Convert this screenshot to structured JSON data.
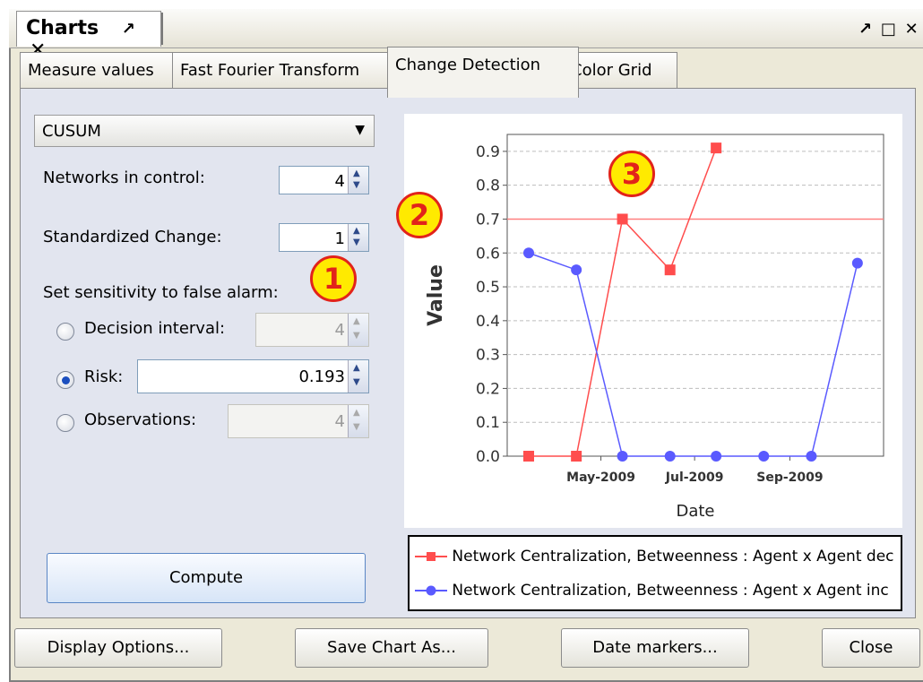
{
  "panel": {
    "title": "Charts",
    "pin_icon": "pin-icon",
    "close_icon": "close-icon"
  },
  "window_controls": {
    "pin_icon": "pin-icon",
    "maximize_icon": "maximize-icon",
    "close_icon": "close-icon"
  },
  "tabs": [
    {
      "label": "Measure values",
      "active": false
    },
    {
      "label": "Fast Fourier Transform",
      "active": false
    },
    {
      "label": "Change Detection",
      "active": true
    },
    {
      "label": "Color Grid",
      "active": false
    }
  ],
  "controls": {
    "method": "CUSUM",
    "networks_in_control_label": "Networks in control:",
    "networks_in_control_value": "4",
    "standardized_change_label": "Standardized Change:",
    "standardized_change_value": "1",
    "sensitivity_label": "Set sensitivity to false alarm:",
    "decision_interval_label": "Decision interval:",
    "decision_interval_value": "4",
    "risk_label": "Risk:",
    "risk_value": "0.193",
    "observations_label": "Observations:",
    "observations_value": "4",
    "selected_option": "risk",
    "compute_label": "Compute"
  },
  "callouts": [
    "1",
    "2",
    "3"
  ],
  "footer": {
    "display_options": "Display Options...",
    "save_chart": "Save Chart As...",
    "date_markers": "Date markers...",
    "close": "Close"
  },
  "colors": {
    "red_series": "#ff4d4d",
    "blue_series": "#5a5aff",
    "threshold": "#ff8080",
    "badge": "#ffea00"
  },
  "chart_data": {
    "type": "line",
    "xlabel": "Date",
    "ylabel": "Value",
    "ylim": [
      0,
      0.95
    ],
    "yticks": [
      "0.0",
      "0.1",
      "0.2",
      "0.3",
      "0.4",
      "0.5",
      "0.6",
      "0.7",
      "0.8",
      "0.9"
    ],
    "xticks": [
      "May-2009",
      "Jul-2009",
      "Sep-2009"
    ],
    "grid": true,
    "x": [
      "2009-03-15",
      "2009-04-15",
      "2009-05-15",
      "2009-06-15",
      "2009-07-15",
      "2009-08-15",
      "2009-09-15",
      "2009-10-15"
    ],
    "threshold": 0.7,
    "legend_position": "bottom",
    "series": [
      {
        "name": "Network Centralization, Betweenness : Agent x Agent dec",
        "marker": "square",
        "color": "#ff4d4d",
        "x": [
          "2009-03-15",
          "2009-04-15",
          "2009-05-15",
          "2009-06-15",
          "2009-07-15"
        ],
        "values": [
          0.0,
          0.0,
          0.7,
          0.55,
          0.91
        ]
      },
      {
        "name": "Network Centralization, Betweenness : Agent x Agent inc",
        "marker": "circle",
        "color": "#5a5aff",
        "x": [
          "2009-03-15",
          "2009-04-15",
          "2009-05-15",
          "2009-06-15",
          "2009-07-15",
          "2009-08-15",
          "2009-09-15",
          "2009-10-15"
        ],
        "values": [
          0.6,
          0.55,
          0.0,
          0.0,
          0.0,
          0.0,
          0.0,
          0.57
        ]
      }
    ]
  }
}
